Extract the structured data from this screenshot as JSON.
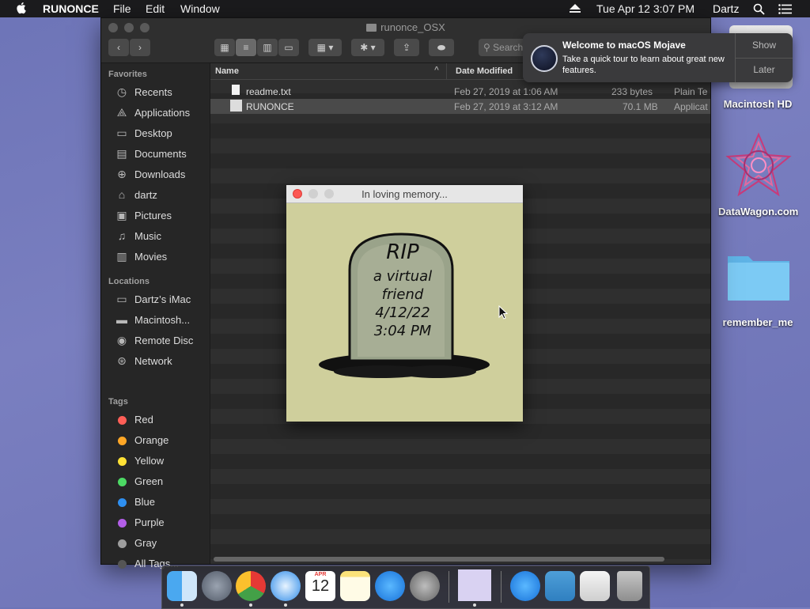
{
  "menubar": {
    "app_name": "RUNONCE",
    "menus": [
      "File",
      "Edit",
      "Window"
    ],
    "datetime": "Tue Apr 12  3:07 PM",
    "user": "Dartz"
  },
  "finder": {
    "title": "runonce_OSX",
    "search_placeholder": "Search",
    "sidebar": {
      "favorites_header": "Favorites",
      "favorites": [
        "Recents",
        "Applications",
        "Desktop",
        "Documents",
        "Downloads",
        "dartz",
        "Pictures",
        "Music",
        "Movies"
      ],
      "locations_header": "Locations",
      "locations": [
        "Dartz’s iMac",
        "Macintosh...",
        "Remote Disc",
        "Network"
      ],
      "tags_header": "Tags",
      "tags": [
        "Red",
        "Orange",
        "Yellow",
        "Green",
        "Blue",
        "Purple",
        "Gray",
        "All Tags..."
      ]
    },
    "columns": {
      "name": "Name",
      "date": "Date Modified"
    },
    "files": [
      {
        "name": "readme.txt",
        "date": "Feb 27, 2019 at 1:06 AM",
        "size": "233 bytes",
        "kind": "Plain Te"
      },
      {
        "name": "RUNONCE",
        "date": "Feb 27, 2019 at 3:12 AM",
        "size": "70.1 MB",
        "kind": "Applicat"
      }
    ]
  },
  "popup": {
    "title": "In loving memory...",
    "lines": [
      "RIP",
      "a virtual",
      "friend",
      "4/12/22",
      "3:04 PM"
    ]
  },
  "notification": {
    "title": "Welcome to macOS Mojave",
    "body": "Take a quick tour to learn about great new features.",
    "show": "Show",
    "later": "Later"
  },
  "desktop": {
    "icons": [
      "Macintosh HD",
      "DataWagon.com",
      "remember_me"
    ]
  },
  "dock": {
    "calendar_month": "APR",
    "calendar_day": "12"
  },
  "colors": {
    "tag_red": "#ff5f57",
    "tag_orange": "#ffa726",
    "tag_yellow": "#ffe135",
    "tag_green": "#4cd964",
    "tag_blue": "#2e8ff0",
    "tag_purple": "#b35ee8",
    "tag_gray": "#9e9e9e"
  }
}
